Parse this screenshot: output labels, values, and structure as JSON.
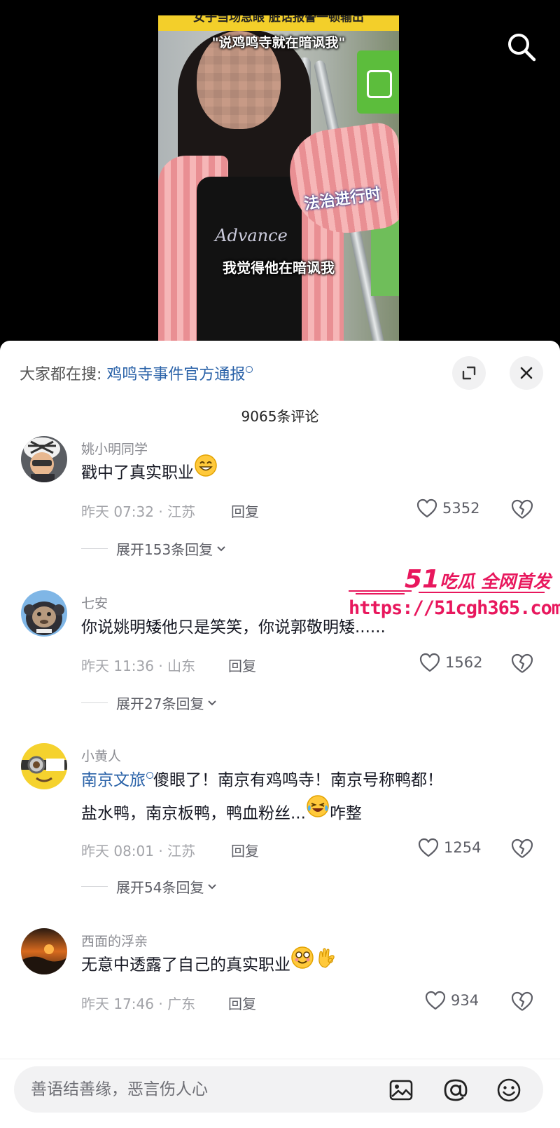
{
  "video": {
    "top_banner": "女子当场急眼 脏话报警一顿输出",
    "quote_caption": "\"说鸡鸣寺就在暗讽我\"",
    "channel_watermark": "法治进行时",
    "subtitle": "我觉得他在暗讽我",
    "shirt_print": "Advance",
    "search_icon": "search-icon"
  },
  "panel": {
    "hot_search_prefix": "大家都在搜:",
    "hot_search_keyword": "鸡鸣寺事件官方通报",
    "expand_icon": "expand-icon",
    "close_icon": "close-icon",
    "comment_count": "9065条评论"
  },
  "comments": [
    {
      "username": "姚小明同学",
      "text": "戳中了真实职业",
      "emoji": "smile",
      "meta": "昨天 07:32 · 江苏",
      "reply_label": "回复",
      "likes": "5352",
      "expand": "展开153条回复"
    },
    {
      "username": "七安",
      "text": "你说姚明矮他只是笑笑，你说郭敬明矮......",
      "meta": "昨天 11:36 · 山东",
      "reply_label": "回复",
      "likes": "1562",
      "expand": "展开27条回复"
    },
    {
      "username": "小黄人",
      "mention": "南京文旅",
      "text_line1": "傻眼了！南京有鸡鸣寺！南京号称鸭都！",
      "text_line2a": "盐水鸭，南京板鸭，鸭血粉丝...",
      "text_line2b": "咋整",
      "emoji": "laughing-crying",
      "meta": "昨天 08:01 · 江苏",
      "reply_label": "回复",
      "likes": "1254",
      "expand": "展开54条回复"
    },
    {
      "username": "西面的浮亲",
      "text": "无意中透露了自己的真实职业",
      "emoji": "dizzy-face, ok-hand",
      "meta": "昨天 17:46 · 广东",
      "reply_label": "回复",
      "likes": "934"
    }
  ],
  "promo": {
    "brand_number": "51",
    "brand_text": "吃瓜 全网首发",
    "url": "https://51cgh365.com"
  },
  "input": {
    "placeholder": "善语结善缘，恶言伤人心",
    "image_icon": "image-icon",
    "at_icon": "at-icon",
    "emoji_icon": "emoji-icon"
  },
  "colors": {
    "link_blue": "#2a62a8",
    "promo_pink": "#e8175d",
    "banner_yellow": "#f3cf2a"
  }
}
